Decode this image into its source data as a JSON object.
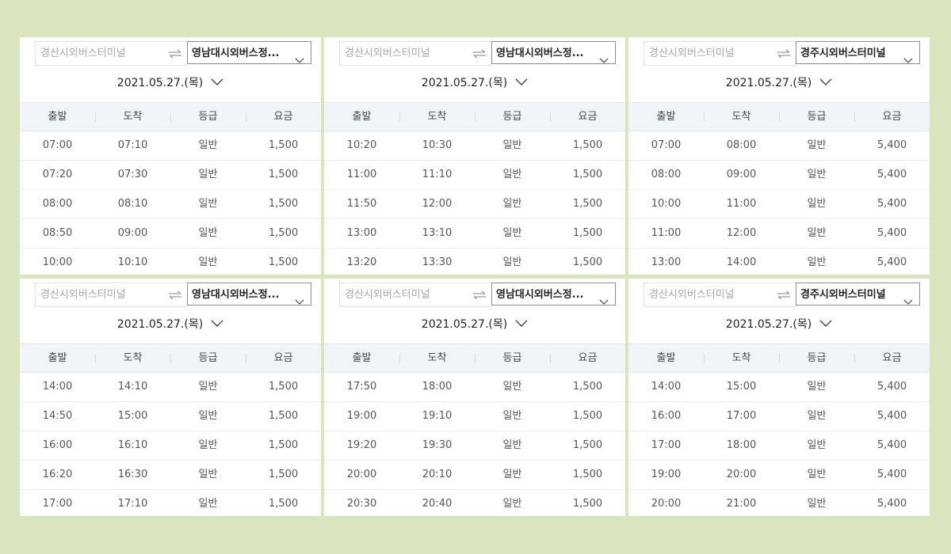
{
  "panels": [
    {
      "origin_placeholder": "경산시외버스터미널",
      "destination": "영남대시외버스정...",
      "date": "2021.05.27.(목)",
      "headers": [
        "출발",
        "도착",
        "등급",
        "요금"
      ],
      "rows": [
        [
          "07:00",
          "07:10",
          "일반",
          "1,500"
        ],
        [
          "07:20",
          "07:30",
          "일반",
          "1,500"
        ],
        [
          "08:00",
          "08:10",
          "일반",
          "1,500"
        ],
        [
          "08:50",
          "09:00",
          "일반",
          "1,500"
        ],
        [
          "10:00",
          "10:10",
          "일반",
          "1,500"
        ]
      ]
    },
    {
      "origin_placeholder": "경산시외버스터미널",
      "destination": "영남대시외버스정...",
      "date": "2021.05.27.(목)",
      "headers": [
        "출발",
        "도착",
        "등급",
        "요금"
      ],
      "rows": [
        [
          "10:20",
          "10:30",
          "일반",
          "1,500"
        ],
        [
          "11:00",
          "11:10",
          "일반",
          "1,500"
        ],
        [
          "11:50",
          "12:00",
          "일반",
          "1,500"
        ],
        [
          "13:00",
          "13:10",
          "일반",
          "1,500"
        ],
        [
          "13:20",
          "13:30",
          "일반",
          "1,500"
        ]
      ]
    },
    {
      "origin_placeholder": "경산시외버스터미널",
      "destination": "경주시외버스터미널",
      "date": "2021.05.27.(목)",
      "headers": [
        "출발",
        "도착",
        "등급",
        "요금"
      ],
      "rows": [
        [
          "07:00",
          "08:00",
          "일반",
          "5,400"
        ],
        [
          "08:00",
          "09:00",
          "일반",
          "5,400"
        ],
        [
          "10:00",
          "11:00",
          "일반",
          "5,400"
        ],
        [
          "11:00",
          "12:00",
          "일반",
          "5,400"
        ],
        [
          "13:00",
          "14:00",
          "일반",
          "5,400"
        ]
      ]
    },
    {
      "origin_placeholder": "경산시외버스터미널",
      "destination": "영남대시외버스정...",
      "date": "2021.05.27.(목)",
      "headers": [
        "출발",
        "도착",
        "등급",
        "요금"
      ],
      "rows": [
        [
          "14:00",
          "14:10",
          "일반",
          "1,500"
        ],
        [
          "14:50",
          "15:00",
          "일반",
          "1,500"
        ],
        [
          "16:00",
          "16:10",
          "일반",
          "1,500"
        ],
        [
          "16:20",
          "16:30",
          "일반",
          "1,500"
        ],
        [
          "17:00",
          "17:10",
          "일반",
          "1,500"
        ]
      ]
    },
    {
      "origin_placeholder": "경산시외버스터미널",
      "destination": "영남대시외버스정...",
      "date": "2021.05.27.(목)",
      "headers": [
        "출발",
        "도착",
        "등급",
        "요금"
      ],
      "rows": [
        [
          "17:50",
          "18:00",
          "일반",
          "1,500"
        ],
        [
          "19:00",
          "19:10",
          "일반",
          "1,500"
        ],
        [
          "19:20",
          "19:30",
          "일반",
          "1,500"
        ],
        [
          "20:00",
          "20:10",
          "일반",
          "1,500"
        ],
        [
          "20:30",
          "20:40",
          "일반",
          "1,500"
        ]
      ]
    },
    {
      "origin_placeholder": "경산시외버스터미널",
      "destination": "경주시외버스터미널",
      "date": "2021.05.27.(목)",
      "headers": [
        "출발",
        "도착",
        "등급",
        "요금"
      ],
      "rows": [
        [
          "14:00",
          "15:00",
          "일반",
          "5,400"
        ],
        [
          "16:00",
          "17:00",
          "일반",
          "5,400"
        ],
        [
          "17:00",
          "18:00",
          "일반",
          "5,400"
        ],
        [
          "19:00",
          "20:00",
          "일반",
          "5,400"
        ],
        [
          "20:00",
          "21:00",
          "일반",
          "5,400"
        ]
      ]
    }
  ],
  "icons": {
    "swap": "swap-arrows-icon",
    "dropdown": "chevron-down-icon",
    "date": "chevron-down-icon"
  },
  "colors": {
    "background": "#d8e5bd",
    "panel": "#ffffff",
    "header_bg": "#f0f5f9"
  }
}
